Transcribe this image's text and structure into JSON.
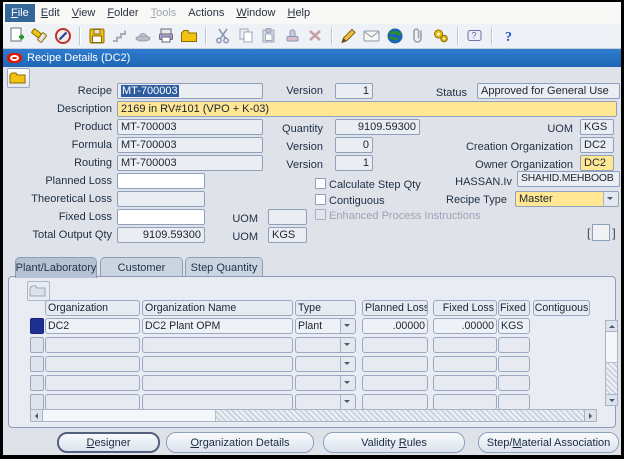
{
  "menubar": {
    "items": [
      {
        "label": "File",
        "mn": 0,
        "state": "selected"
      },
      {
        "label": "Edit",
        "mn": 0,
        "state": "normal"
      },
      {
        "label": "View",
        "mn": 0,
        "state": "normal"
      },
      {
        "label": "Folder",
        "mn": 0,
        "state": "normal"
      },
      {
        "label": "Tools",
        "mn": 0,
        "state": "disabled"
      },
      {
        "label": "Actions",
        "mn": -1,
        "state": "normal"
      },
      {
        "label": "Window",
        "mn": 0,
        "state": "normal"
      },
      {
        "label": "Help",
        "mn": 0,
        "state": "normal"
      }
    ]
  },
  "toolbar": {
    "icons": [
      "new",
      "find",
      "navigator",
      "save",
      "next-step",
      "switch-responsibility",
      "print",
      "close-form",
      "cut",
      "copy",
      "paste",
      "clear-record",
      "delete",
      "edit-field",
      "zoom",
      "translations",
      "attachments",
      "folder-tools",
      "window-help",
      "help"
    ]
  },
  "window": {
    "title": "Recipe Details (DC2)"
  },
  "form": {
    "recipe_label": "Recipe",
    "recipe_value": "MT-700003",
    "version_label": "Version",
    "recipe_version": "1",
    "status_label": "Status",
    "status_value": "Approved for General Use",
    "description_label": "Description",
    "description_value": "2169 in RV#101 (VPO + K-03)",
    "product_label": "Product",
    "product_value": "MT-700003",
    "quantity_label": "Quantity",
    "quantity_value": "9109.59300",
    "uom_label": "UOM",
    "uom_value": "KGS",
    "formula_label": "Formula",
    "formula_value": "MT-700003",
    "formula_version": "0",
    "creation_org_label": "Creation Organization",
    "creation_org_value": "DC2",
    "routing_label": "Routing",
    "routing_value": "MT-700003",
    "routing_version": "1",
    "owner_org_label": "Owner Organization",
    "owner_org_value": "DC2",
    "planned_loss_label": "Planned Loss",
    "planned_loss_value": "",
    "calc_step_qty_label": "Calculate Step Qty",
    "user_label": "HASSAN.Iv",
    "user_value": "SHAHID.MEHBOOB",
    "theoretical_loss_label": "Theoretical Loss",
    "theoretical_loss_value": "",
    "contiguous_label": "Contiguous",
    "recipe_type_label": "Recipe Type",
    "recipe_type_value": "Master",
    "fixed_loss_label": "Fixed Loss",
    "fixed_loss_value": "",
    "fixed_uom_label": "UOM",
    "fixed_uom_value": "",
    "enhanced_label": "Enhanced Process Instructions",
    "total_output_label": "Total Output Qty",
    "total_output_value": "9109.59300",
    "total_uom_label": "UOM",
    "total_uom_value": "KGS",
    "bracket_open": "[",
    "bracket_close": "]"
  },
  "tabs": [
    {
      "label": "Plant/Laboratory",
      "active": true
    },
    {
      "label": "Customer",
      "active": false
    },
    {
      "label": "Step Quantity",
      "active": false
    }
  ],
  "table": {
    "headers": {
      "organization": "Organization",
      "organization_name": "Organization Name",
      "type": "Type",
      "planned_loss": "Planned Loss",
      "fixed_loss": "Fixed Loss",
      "fixed_loss_uom": "Fixed L",
      "contiguous": "Contiguous"
    },
    "rows": [
      {
        "organization": "DC2",
        "organization_name": "DC2 Plant OPM",
        "type": "Plant",
        "planned_loss": ".00000",
        "fixed_loss": ".00000",
        "fixed_loss_uom": "KGS",
        "contiguous": false,
        "selected": true
      },
      {
        "organization": "",
        "organization_name": "",
        "type": "",
        "planned_loss": "",
        "fixed_loss": "",
        "fixed_loss_uom": "",
        "contiguous": false,
        "selected": false
      },
      {
        "organization": "",
        "organization_name": "",
        "type": "",
        "planned_loss": "",
        "fixed_loss": "",
        "fixed_loss_uom": "",
        "contiguous": false,
        "selected": false
      },
      {
        "organization": "",
        "organization_name": "",
        "type": "",
        "planned_loss": "",
        "fixed_loss": "",
        "fixed_loss_uom": "",
        "contiguous": false,
        "selected": false
      },
      {
        "organization": "",
        "organization_name": "",
        "type": "",
        "planned_loss": "",
        "fixed_loss": "",
        "fixed_loss_uom": "",
        "contiguous": false,
        "selected": false
      }
    ]
  },
  "buttons": [
    {
      "label": "Designer",
      "mn": 0,
      "focused": true
    },
    {
      "label": "Organization Details",
      "mn": 0,
      "focused": false
    },
    {
      "label": "Validity Rules",
      "mn": 9,
      "focused": false
    },
    {
      "label": "Step/Material Association",
      "mn": 5,
      "focused": false
    }
  ],
  "colors": {
    "titlebar": "#2673c4",
    "required_field": "#ffe794",
    "selection": "#2e5c9e",
    "record_selector": "#1d2f93"
  }
}
